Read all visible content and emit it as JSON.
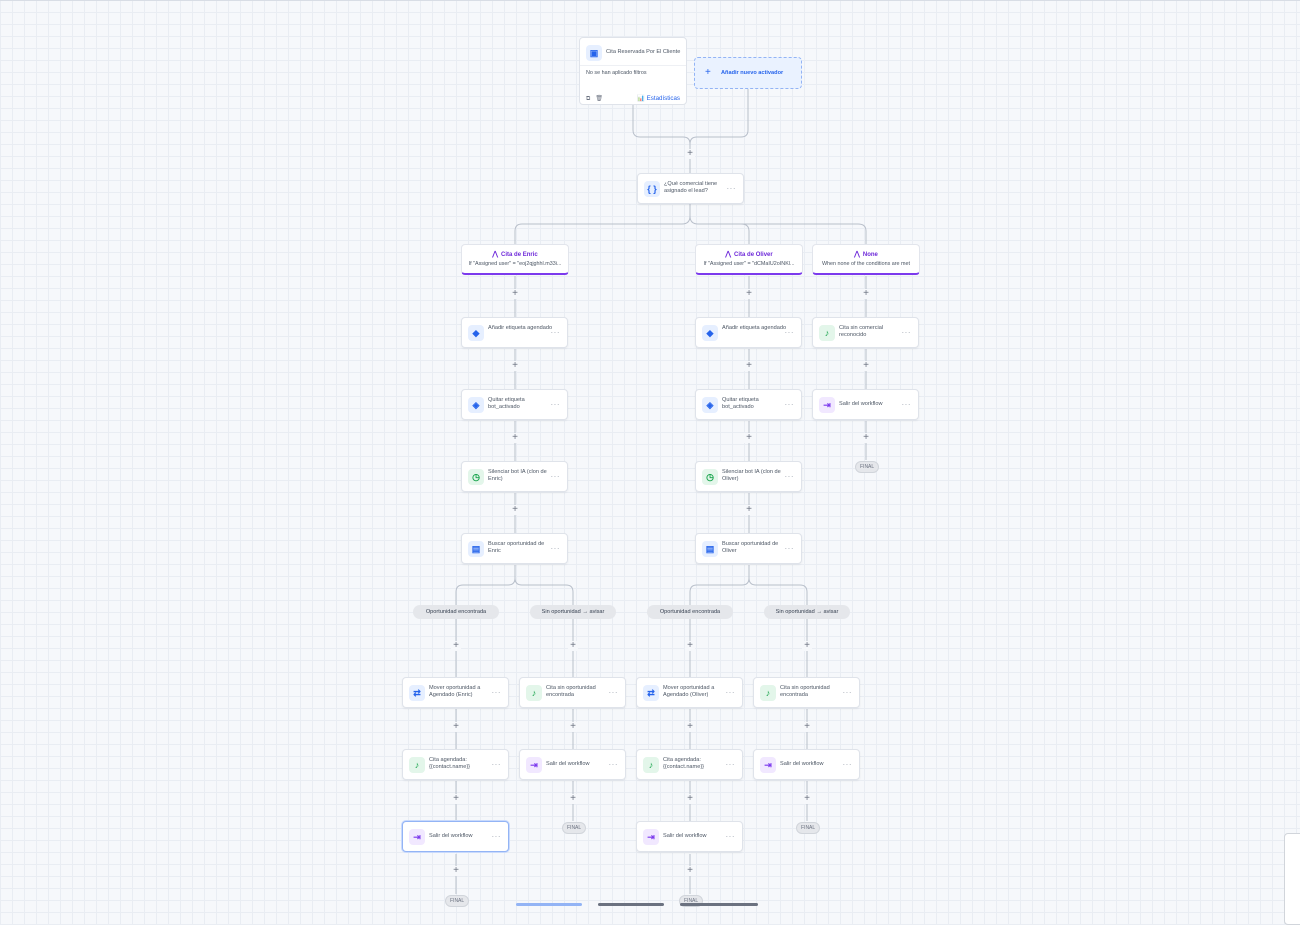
{
  "trigger": {
    "title": "Cita Reservada Por El Cliente",
    "filters": "No se han aplicado filtros",
    "copy_icon": "copy-icon",
    "delete_icon": "trash-icon",
    "stats_label": "Estadísticas"
  },
  "add_trigger": {
    "label": "Añadir nuevo activador"
  },
  "router": {
    "label": "¿Qué comercial tiene asignado el lead?"
  },
  "conditions": {
    "enric": {
      "title": "Cita de Enric",
      "rule": "If \"Assigned user\" = \"eoj2qjghhl.m33i..."
    },
    "oliver": {
      "title": "Cita de Oliver",
      "rule": "If \"Assigned user\" = \"dCMaIU2oINKl..."
    },
    "none": {
      "title": "None",
      "rule": "When none of the conditions are met"
    }
  },
  "enric_actions": [
    {
      "label": "Añadir etiqueta agendado",
      "icon": "tag-icon"
    },
    {
      "label": "Quitar etiqueta bot_activado",
      "icon": "tag-remove-icon"
    },
    {
      "label": "Silenciar bot IA (clon de Enric)",
      "icon": "timer-icon"
    },
    {
      "label": "Buscar oportunidad de Enric",
      "icon": "search-opportunity-icon"
    }
  ],
  "oliver_actions": [
    {
      "label": "Añadir etiqueta agendado",
      "icon": "tag-icon"
    },
    {
      "label": "Quitar etiqueta bot_activado",
      "icon": "tag-remove-icon"
    },
    {
      "label": "Silenciar bot IA (clon de Oliver)",
      "icon": "timer-icon"
    },
    {
      "label": "Buscar oportunidad de Oliver",
      "icon": "search-opportunity-icon"
    }
  ],
  "none_actions": [
    {
      "label": "Cita sin comercial reconocido",
      "icon": "bell-icon"
    },
    {
      "label": "Salir del workflow",
      "icon": "exit-icon"
    }
  ],
  "branch_labels": {
    "found": "Oportunidad encontrada",
    "not_found": "Sin oportunidad → avisar"
  },
  "enric_found": [
    {
      "label": "Mover oportunidad a Agendado (Enric)",
      "icon": "move-opportunity-icon"
    },
    {
      "label": "Cita agendada: {{contact.name}}",
      "icon": "bell-icon"
    },
    {
      "label": "Salir del workflow",
      "icon": "exit-icon"
    }
  ],
  "enric_not_found": [
    {
      "label": "Cita sin oportunidad encontrada",
      "icon": "bell-icon"
    },
    {
      "label": "Salir del workflow",
      "icon": "exit-icon"
    }
  ],
  "oliver_found": [
    {
      "label": "Mover oportunidad a Agendado (Oliver)",
      "icon": "move-opportunity-icon"
    },
    {
      "label": "Cita agendada: {{contact.name}}",
      "icon": "bell-icon"
    },
    {
      "label": "Salir del workflow",
      "icon": "exit-icon"
    }
  ],
  "oliver_not_found": [
    {
      "label": "Cita sin oportunidad encontrada",
      "icon": "bell-icon"
    },
    {
      "label": "Salir del workflow",
      "icon": "exit-icon"
    }
  ],
  "final_label": "FINAL",
  "more_menu": "···",
  "add_step": "+",
  "colors": {
    "accent": "#2563eb",
    "condition": "#7c3aed",
    "success": "#16a34a"
  }
}
